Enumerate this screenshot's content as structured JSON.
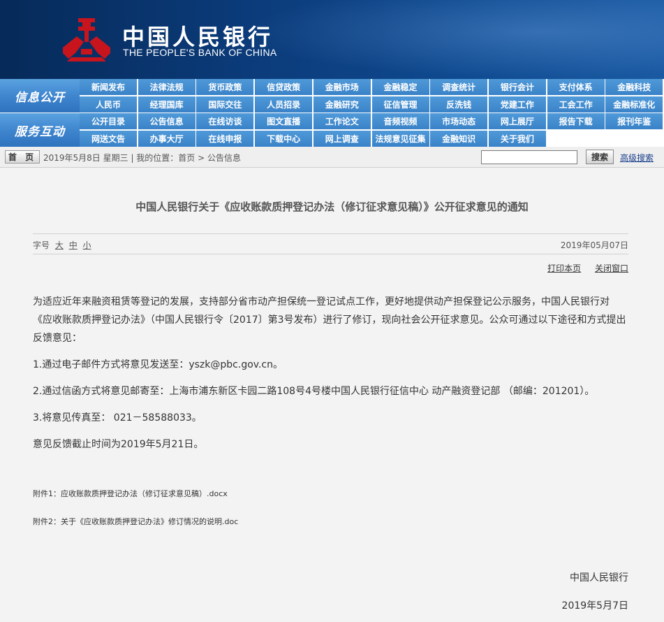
{
  "header": {
    "bank_name_cn": "中国人民银行",
    "bank_name_en": "THE PEOPLE'S BANK OF CHINA",
    "logo_icon": "pboc-emblem-icon",
    "brand_color": "#c8151d"
  },
  "nav": {
    "section1_label": "信息公开",
    "section2_label": "服务互动",
    "row1": [
      "新闻发布",
      "法律法规",
      "货币政策",
      "信贷政策",
      "金融市场",
      "金融稳定",
      "调查统计",
      "银行会计",
      "支付体系",
      "金融科技"
    ],
    "row2": [
      "人民币",
      "经理国库",
      "国际交往",
      "人员招录",
      "金融研究",
      "征信管理",
      "反洗钱",
      "党建工作",
      "工会工作",
      "金融标准化"
    ],
    "row3": [
      "公开目录",
      "公告信息",
      "在线访谈",
      "图文直播",
      "工作论文",
      "音频视频",
      "市场动态",
      "网上展厅",
      "报告下载",
      "报刊年鉴"
    ],
    "row4": [
      "网送文告",
      "办事大厅",
      "在线申报",
      "下载中心",
      "网上调查",
      "法规意见征集",
      "金融知识",
      "关于我们"
    ]
  },
  "crumbbar": {
    "home_label": "首 页",
    "date_text": "2019年5月8日  星期三  |  我的位置：首页 > 公告信息",
    "search_placeholder": "",
    "search_label": "搜索",
    "advanced_label": "高级搜索"
  },
  "article": {
    "title": "中国人民银行关于《应收账款质押登记办法（修订征求意见稿）》公开征求意见的通知",
    "font_size_label": "字号",
    "font_large": "大",
    "font_medium": "中",
    "font_small": "小",
    "pub_date": "2019年05月07日",
    "print_label": "打印本页",
    "close_label": "关闭窗口",
    "paragraphs": [
      "为适应近年来融资租赁等登记的发展，支持部分省市动产担保统一登记试点工作，更好地提供动产担保登记公示服务，中国人民银行对《应收账款质押登记办法》（中国人民银行令〔2017〕第3号发布）进行了修订，现向社会公开征求意见。公众可通过以下途径和方式提出反馈意见：",
      "1.通过电子邮件方式将意见发送至：yszk@pbc.gov.cn。",
      "2.通过信函方式将意见邮寄至：上海市浦东新区卡园二路108号4号楼中国人民银行征信中心 动产融资登记部 （邮编：201201）。",
      "3.将意见传真至： 021－58588033。",
      "意见反馈截止时间为2019年5月21日。"
    ],
    "attachment1": "附件1：应收账款质押登记办法（修订征求意见稿）.docx",
    "attachment2": "附件2：关于《应收账款质押登记办法》修订情况的说明.doc",
    "signer": "中国人民银行",
    "sign_date": "2019年5月7日"
  }
}
